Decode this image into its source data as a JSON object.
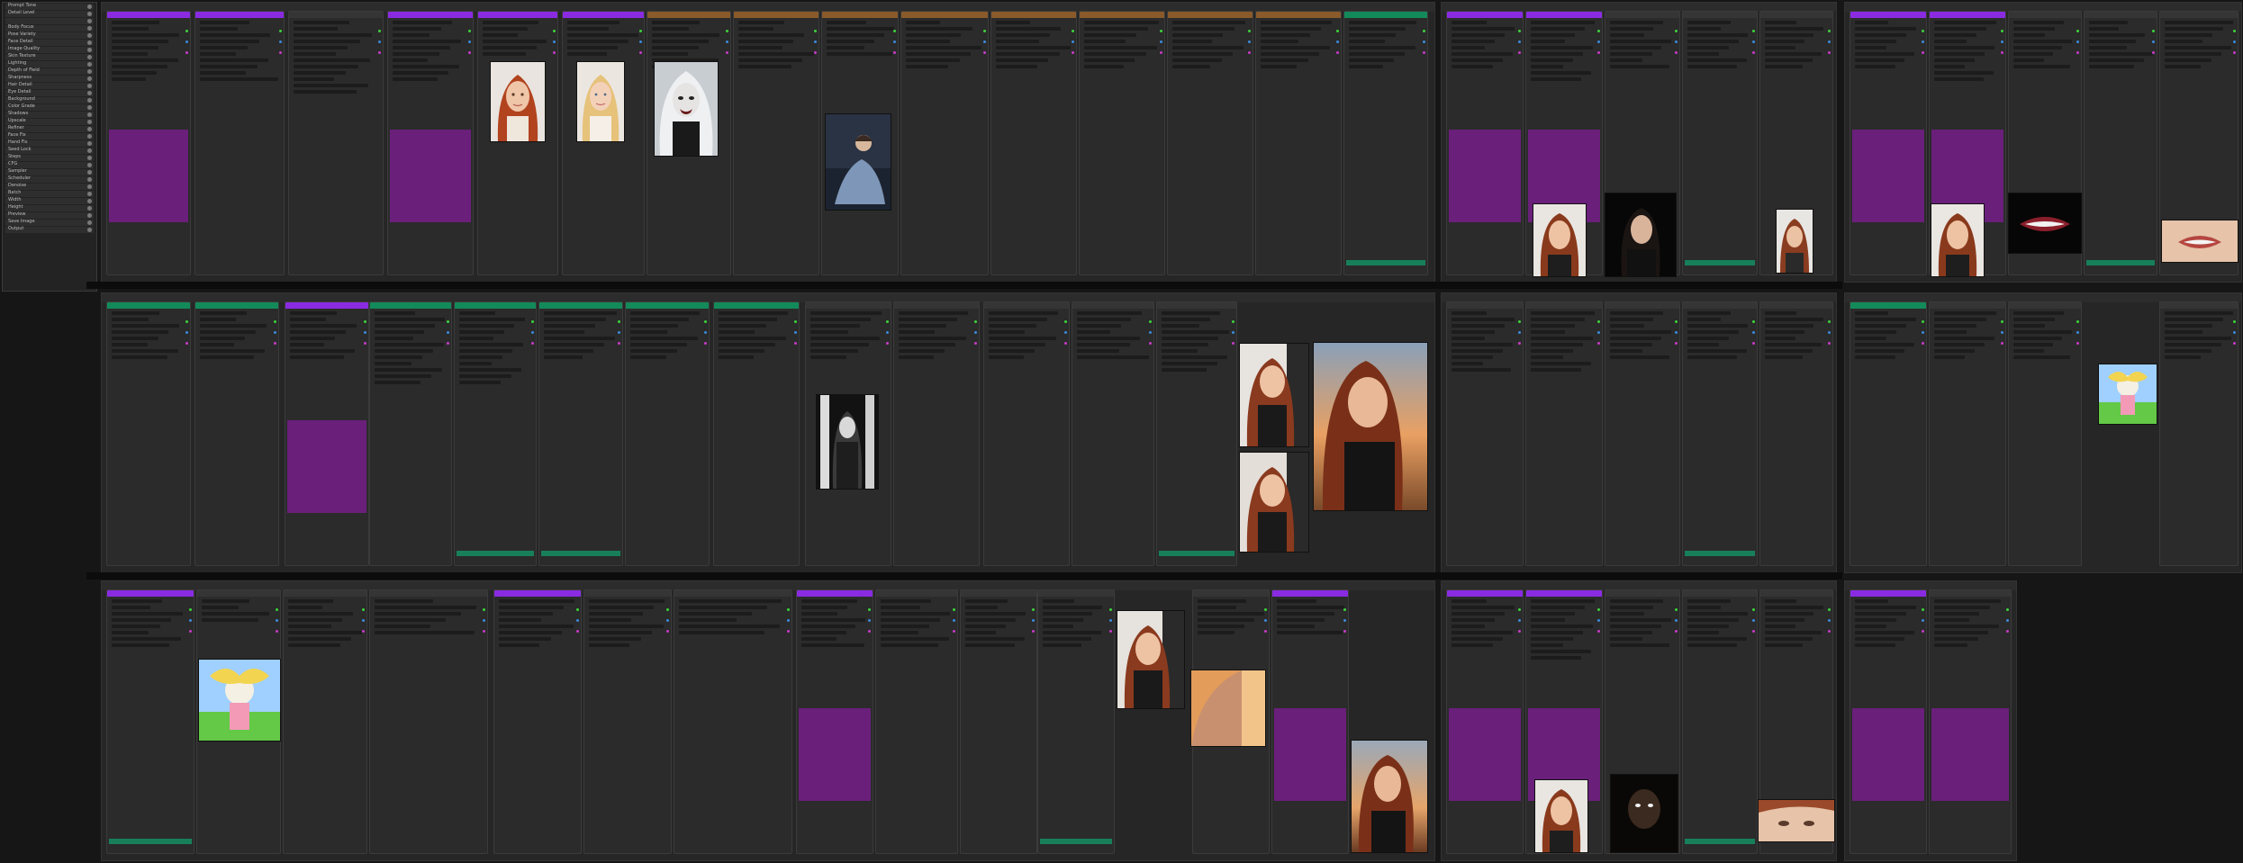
{
  "app": {
    "title": "",
    "accent_purple": "#8a2be2",
    "accent_green": "#138a5a",
    "accent_orange": "#8a5a2a",
    "background": "#161616"
  },
  "sidebar": {
    "items": [
      {
        "label": "Prompt Tone",
        "toggle": true
      },
      {
        "label": "Detail Level",
        "toggle": true
      },
      {
        "label": "",
        "toggle": true
      },
      {
        "label": "Body Focus",
        "toggle": true
      },
      {
        "label": "Pose Variety",
        "toggle": true
      },
      {
        "label": "Face Detail",
        "toggle": true
      },
      {
        "label": "Image Quality",
        "toggle": true
      },
      {
        "label": "Skin Texture",
        "toggle": true
      },
      {
        "label": "Lighting",
        "toggle": true
      },
      {
        "label": "Depth of Field",
        "toggle": true
      },
      {
        "label": "Sharpness",
        "toggle": true
      },
      {
        "label": "Hair Detail",
        "toggle": true
      },
      {
        "label": "Eye Detail",
        "toggle": true
      },
      {
        "label": "Background",
        "toggle": true
      },
      {
        "label": "Color Grade",
        "toggle": true
      },
      {
        "label": "Shadows",
        "toggle": true
      },
      {
        "label": "Upscale",
        "toggle": true
      },
      {
        "label": "Refiner",
        "toggle": true
      },
      {
        "label": "Face Fix",
        "toggle": true
      },
      {
        "label": "Hand Fix",
        "toggle": true
      },
      {
        "label": "Seed Lock",
        "toggle": true
      },
      {
        "label": "Steps",
        "toggle": true
      },
      {
        "label": "CFG",
        "toggle": true
      },
      {
        "label": "Sampler",
        "toggle": true
      },
      {
        "label": "Scheduler",
        "toggle": true
      },
      {
        "label": "Denoise",
        "toggle": true
      },
      {
        "label": "Batch",
        "toggle": true
      },
      {
        "label": "Width",
        "toggle": true
      },
      {
        "label": "Height",
        "toggle": true
      },
      {
        "label": "Preview",
        "toggle": true
      },
      {
        "label": "Save Image",
        "toggle": true
      },
      {
        "label": "Output",
        "toggle": true
      }
    ]
  },
  "groups": [
    {
      "name": "",
      "row": 1
    },
    {
      "name": "",
      "row": 1
    },
    {
      "name": "",
      "row": 1
    },
    {
      "name": "",
      "row": 2
    },
    {
      "name": "",
      "row": 2
    },
    {
      "name": "",
      "row": 2
    },
    {
      "name": "",
      "row": 3
    },
    {
      "name": "",
      "row": 3
    },
    {
      "name": "",
      "row": 3
    }
  ],
  "previews": [
    {
      "subject": "red-haired woman portrait"
    },
    {
      "subject": "blonde woman portrait"
    },
    {
      "subject": "pale vampire portrait"
    },
    {
      "subject": "woman in blue dress sitting"
    },
    {
      "subject": "dark-haired woman portrait"
    },
    {
      "subject": "red-haired woman smiling"
    },
    {
      "subject": "smiling lips close-up"
    },
    {
      "subject": "cartoon girl with blonde pigtails"
    },
    {
      "subject": "black and white woman in doorway"
    },
    {
      "subject": "woman at sunset"
    },
    {
      "subject": "woman at sunset close"
    }
  ]
}
